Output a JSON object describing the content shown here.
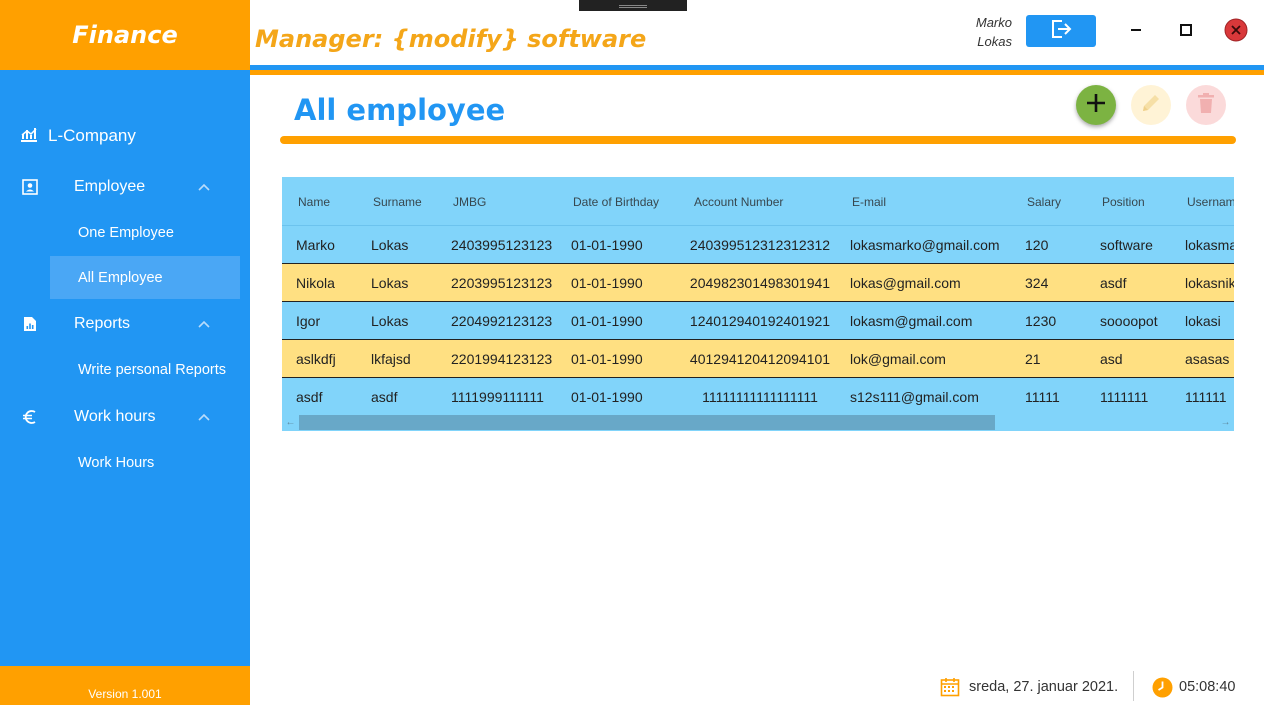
{
  "sidebar": {
    "brand": "Finance",
    "company": "L-Company",
    "groups": [
      {
        "label": "Employee",
        "items": [
          "One Employee",
          "All Employee"
        ]
      },
      {
        "label": "Reports",
        "items": [
          "Write personal Reports"
        ]
      },
      {
        "label": "Work hours",
        "items": [
          "Work Hours"
        ]
      }
    ],
    "active_item": "All Employee",
    "version": "Version 1.001"
  },
  "header": {
    "title": "Manager: {modify} software",
    "user_first": "Marko",
    "user_last": "Lokas"
  },
  "main": {
    "title": "All employee"
  },
  "table": {
    "columns": [
      "Name",
      "Surname",
      "JMBG",
      "Date of Birthday",
      "Account Number",
      "E-mail",
      "Salary",
      "Position",
      "Usernam"
    ],
    "rows": [
      [
        "Marko",
        "Lokas",
        "2403995123123",
        "01-01-1990",
        "240399512312312312",
        "lokasmarko@gmail.com",
        "120",
        "software",
        "lokasma"
      ],
      [
        "Nikola",
        "Lokas",
        "2203995123123",
        "01-01-1990",
        "204982301498301941",
        "lokas@gmail.com",
        "324",
        "asdf",
        "lokasnik"
      ],
      [
        "Igor",
        "Lokas",
        "2204992123123",
        "01-01-1990",
        "124012940192401921",
        "lokasm@gmail.com",
        "1230",
        "soooopot",
        "lokasi"
      ],
      [
        "aslkdfj",
        "lkfajsd",
        "2201994123123",
        "01-01-1990",
        "401294120412094101",
        "lok@gmail.com",
        "21",
        "asd",
        "asasas"
      ],
      [
        "asdf",
        "asdf",
        "1111999111111",
        "01-01-1990",
        "11111111111111111",
        "s12s111@gmail.com",
        "11111",
        "1111111",
        "111111"
      ]
    ]
  },
  "status": {
    "date": "sreda, 27. januar 2021.",
    "time": "05:08:40"
  },
  "colors": {
    "primary": "#2196f3",
    "accent": "#ffa000",
    "row_blue": "#81d4fa",
    "row_yellow": "#ffe082",
    "add": "#7cb342"
  },
  "icons": {
    "company": "chart-icon",
    "employee": "badge-icon",
    "reports": "report-icon",
    "work_hours": "euro-icon",
    "logout": "logout-icon",
    "add": "plus-icon",
    "edit": "pencil-icon",
    "delete": "trash-icon",
    "date": "calendar-icon",
    "time": "clock-icon"
  }
}
